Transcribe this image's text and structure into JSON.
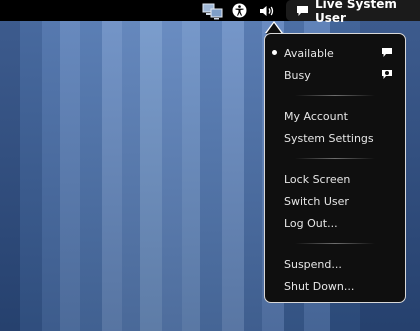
{
  "top_bar": {
    "user_name": "Live System User",
    "icons": [
      "network-icon",
      "accessibility-icon",
      "volume-icon",
      "chat-bubble-icon"
    ]
  },
  "user_menu": {
    "status": {
      "available": "Available",
      "busy": "Busy",
      "selected": "Available"
    },
    "account": {
      "my_account": "My Account",
      "system_settings": "System Settings"
    },
    "session": {
      "lock_screen": "Lock Screen",
      "switch_user": "Switch User",
      "log_out": "Log Out..."
    },
    "power": {
      "suspend": "Suspend...",
      "shut_down": "Shut Down..."
    }
  }
}
